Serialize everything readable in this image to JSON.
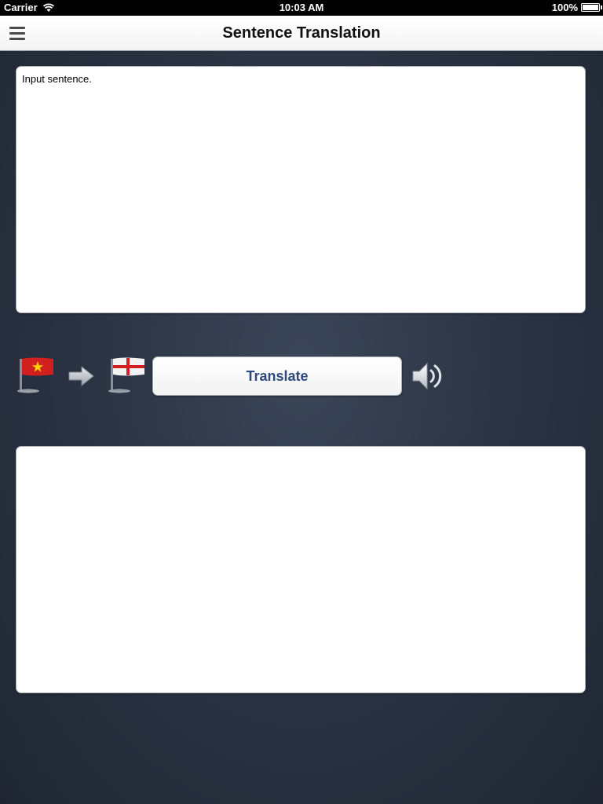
{
  "status_bar": {
    "carrier": "Carrier",
    "time": "10:03 AM",
    "battery": "100%",
    "icons": [
      "wifi-icon",
      "battery-icon"
    ]
  },
  "nav_bar": {
    "title": "Sentence Translation",
    "menu_icon": "menu-icon"
  },
  "input": {
    "value": "",
    "placeholder": "Input sentence."
  },
  "controls": {
    "source_flag": "vietnam-flag-icon",
    "direction_icon": "arrow-right-icon",
    "target_flag": "england-flag-icon",
    "translate_label": "Translate",
    "speak_icon": "speaker-icon"
  },
  "output": {
    "value": ""
  },
  "colors": {
    "accent": "#2e4a7e",
    "background": "#2c3545",
    "flag_red": "#d21f1f",
    "flag_star": "#f7d000"
  }
}
